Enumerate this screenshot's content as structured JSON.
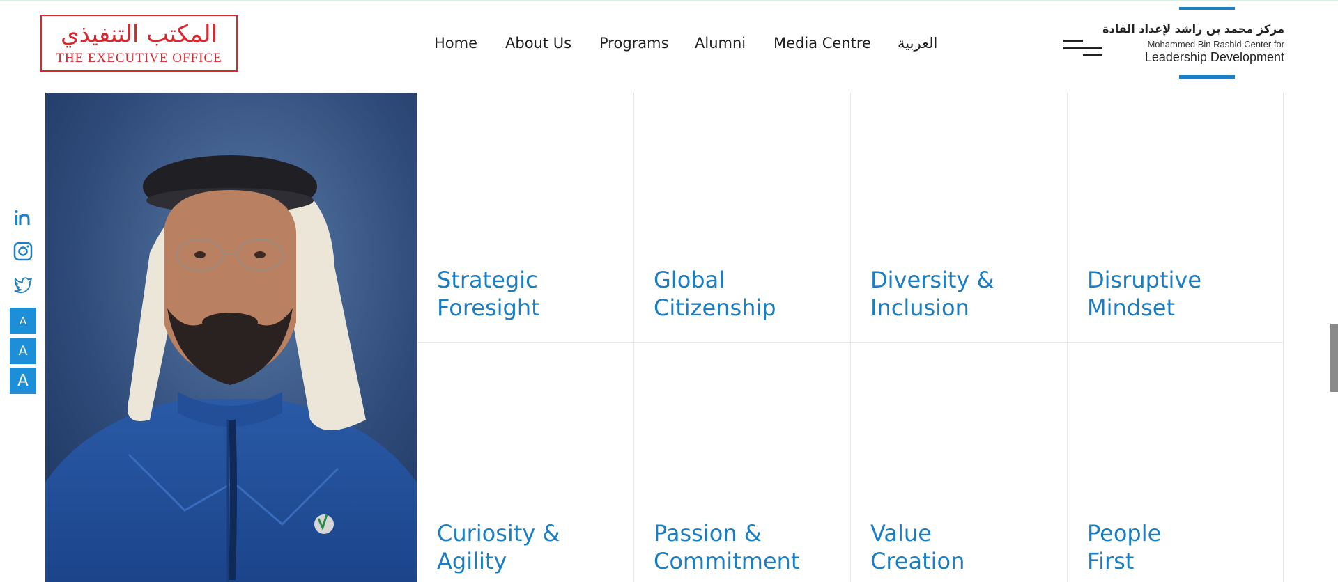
{
  "header": {
    "logo_left": {
      "arabic": "المكتب التنفيذي",
      "english": "THE EXECUTIVE OFFICE"
    },
    "nav": [
      {
        "label": "Home"
      },
      {
        "label": "About Us"
      },
      {
        "label": "Programs"
      },
      {
        "label": "Alumni"
      },
      {
        "label": "Media Centre"
      },
      {
        "label": "العربية"
      }
    ],
    "logo_right": {
      "arabic": "مركز محمد بن راشد لإعداد القادة",
      "english_line1": "Mohammed Bin Rashid Center for",
      "english_line2": "Leadership Development"
    }
  },
  "sidebar": {
    "social": [
      "linkedin-icon",
      "instagram-icon",
      "twitter-icon"
    ],
    "font_size_buttons": [
      {
        "label": "A",
        "size": "small"
      },
      {
        "label": "A",
        "size": "medium"
      },
      {
        "label": "A",
        "size": "large"
      }
    ]
  },
  "values_grid": {
    "items": [
      {
        "line1": "Strategic",
        "line2": "Foresight"
      },
      {
        "line1": "Global",
        "line2": "Citizenship"
      },
      {
        "line1": "Diversity &",
        "line2": "Inclusion"
      },
      {
        "line1": "Disruptive",
        "line2": "Mindset"
      },
      {
        "line1": "Curiosity &",
        "line2": "Agility"
      },
      {
        "line1": "Passion &",
        "line2": "Commitment"
      },
      {
        "line1": "Value",
        "line2": "Creation"
      },
      {
        "line1": "People",
        "line2": "First"
      }
    ]
  },
  "colors": {
    "accent_blue": "#1b7ec2",
    "brand_red": "#d9272e",
    "button_blue": "#1d8fd9"
  }
}
